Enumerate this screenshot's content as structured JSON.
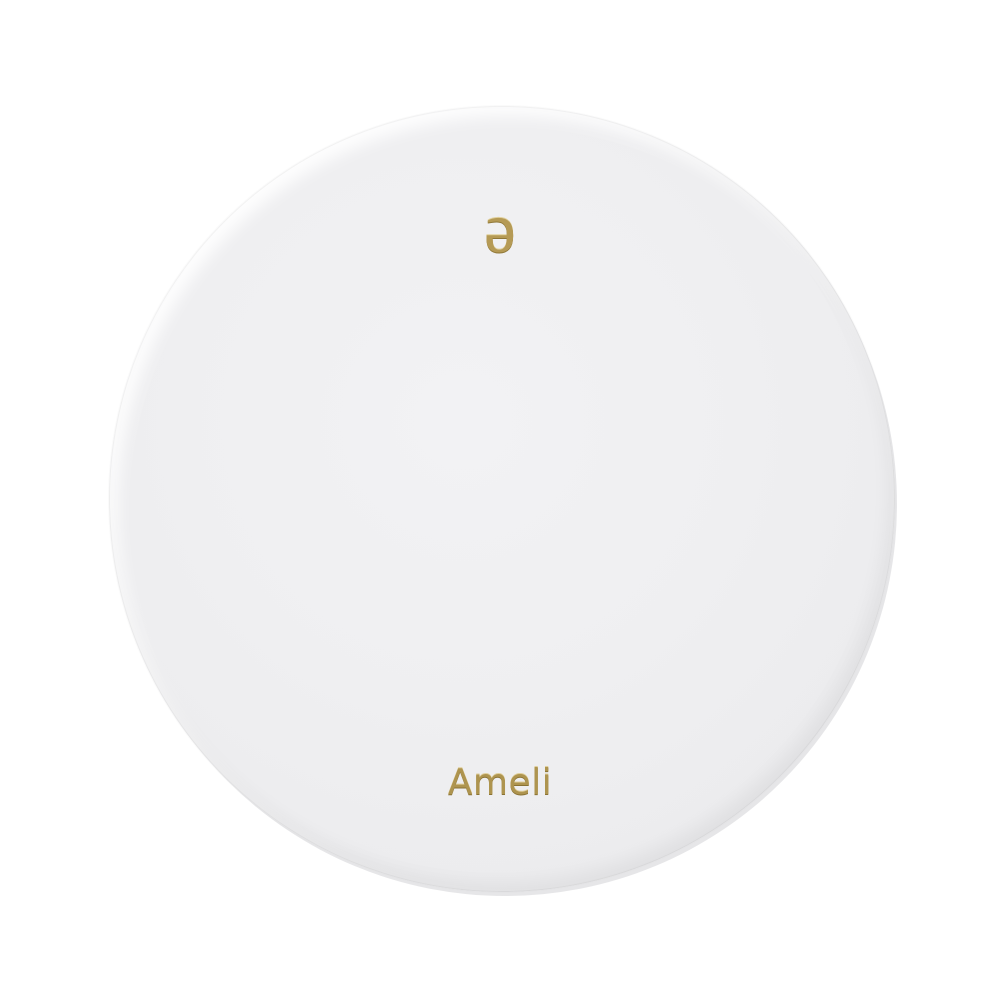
{
  "product": {
    "monogram": "ə",
    "brand": "Ameli"
  },
  "colors": {
    "background": "#ffffff",
    "lid": "#efeff1",
    "gold_foil": "#b59a55"
  }
}
